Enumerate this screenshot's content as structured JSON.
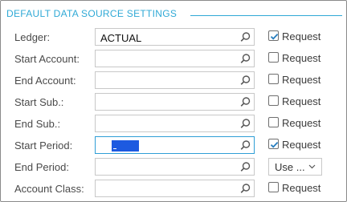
{
  "section": {
    "title": "DEFAULT DATA SOURCE SETTINGS"
  },
  "rows": [
    {
      "label": "Ledger:",
      "value": "ACTUAL",
      "option": {
        "type": "checkbox",
        "label": "Request",
        "checked": true
      }
    },
    {
      "label": "Start Account:",
      "value": "",
      "option": {
        "type": "checkbox",
        "label": "Request",
        "checked": false
      }
    },
    {
      "label": "End Account:",
      "value": "",
      "option": {
        "type": "checkbox",
        "label": "Request",
        "checked": false
      }
    },
    {
      "label": "Start Sub.:",
      "value": "",
      "option": {
        "type": "checkbox",
        "label": "Request",
        "checked": false
      }
    },
    {
      "label": "End Sub.:",
      "value": "",
      "option": {
        "type": "checkbox",
        "label": "Request",
        "checked": false
      }
    },
    {
      "label": "Start Period:",
      "value": "",
      "focused": true,
      "option": {
        "type": "checkbox",
        "label": "Request",
        "checked": true
      }
    },
    {
      "label": "End Period:",
      "value": "",
      "option": {
        "type": "select",
        "value": "Use ..."
      }
    },
    {
      "label": "Account Class:",
      "value": "",
      "option": {
        "type": "checkbox",
        "label": "Request",
        "checked": false
      }
    }
  ],
  "icons": {
    "lookup": "search-icon",
    "dropdown": "chevron-down-icon",
    "check": "checkmark-icon"
  },
  "colors": {
    "accent": "#2fa9d6",
    "selection": "#1d5ae0",
    "check": "#2a7fbf"
  }
}
